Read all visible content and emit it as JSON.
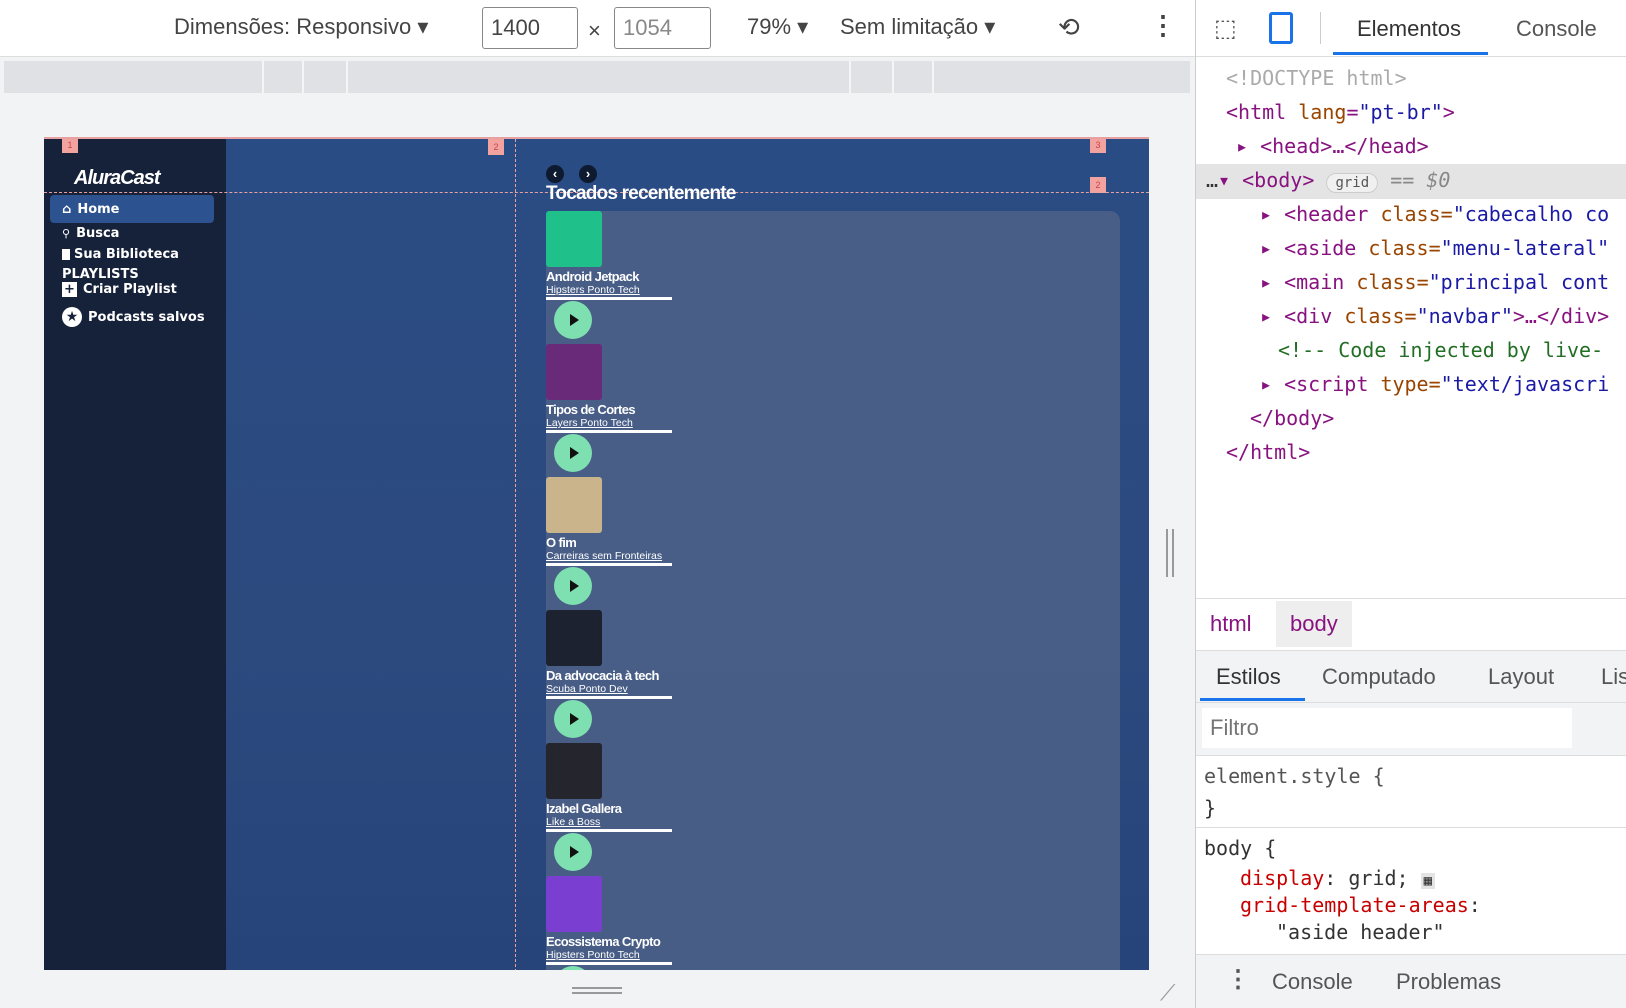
{
  "toolbar": {
    "dimensions_label": "Dimensões: Responsivo",
    "width": "1400",
    "times": "×",
    "height": "1054",
    "zoom": "79%",
    "throttle": "Sem limitação"
  },
  "site": {
    "logo": "AluraCast",
    "nav": [
      {
        "label": "Home",
        "icon": "home-icon"
      },
      {
        "label": "Busca",
        "icon": "search-icon"
      },
      {
        "label": "Sua Biblioteca",
        "icon": "bookmark-icon"
      }
    ],
    "playlists_heading": "PLAYLISTS",
    "create_playlist": "Criar Playlist",
    "saved": "Podcasts salvos",
    "section_title": "Tocados recentemente",
    "cards": [
      {
        "title": "Android Jetpack",
        "subtitle": "Hipsters Ponto Tech",
        "color": "#1fc08a"
      },
      {
        "title": "Tipos de Cortes",
        "subtitle": "Layers Ponto Tech",
        "color": "#6a2a7a"
      },
      {
        "title": "O fim",
        "subtitle": "Carreiras sem Fronteiras",
        "color": "#c9b48c"
      },
      {
        "title": "Da advocacia à tech",
        "subtitle": "Scuba Ponto Dev",
        "color": "#1d2230"
      },
      {
        "title": "Izabel Gallera",
        "subtitle": "Like a Boss",
        "color": "#25252d"
      },
      {
        "title": "Ecossistema Crypto",
        "subtitle": "Hipsters Ponto Tech",
        "color": "#7a3fd0"
      }
    ]
  },
  "devtools": {
    "tabs": [
      "Elementos",
      "Console"
    ],
    "code": {
      "doctype": "<!DOCTYPE html>",
      "html_open": "<html",
      "lang_attr": "lang",
      "lang_val": "\"pt-br\"",
      "head": "<head>…</head>",
      "body": "<body>",
      "grid_badge": "grid",
      "eq": "== $0",
      "header": "<header",
      "header_attr": "class=",
      "header_val": "\"cabecalho co",
      "aside": "<aside",
      "aside_val": "\"menu-lateral\"",
      "main": "<main",
      "main_val": "\"principal cont",
      "div": "<div",
      "div_val": "\"navbar\"",
      "div_rest": ">…</div>",
      "comment": "<!-- Code injected by live-",
      "script": "<script",
      "script_attr": "type=",
      "script_val": "\"text/javascri",
      "body_close": "</body>",
      "html_close": "</html>",
      "class_attr": "class="
    },
    "breadcrumb": [
      "html",
      "body"
    ],
    "style_tabs": [
      "Estilos",
      "Computado",
      "Layout",
      "Lis"
    ],
    "filter_placeholder": "Filtro",
    "element_style": "element.style {",
    "close_brace": "}",
    "rule_selector": "body {",
    "prop1": "display",
    "val1": "grid;",
    "prop2": "grid-template-areas",
    "val2": "\"aside header\"",
    "drawer_tabs": [
      "Console",
      "Problemas"
    ]
  }
}
